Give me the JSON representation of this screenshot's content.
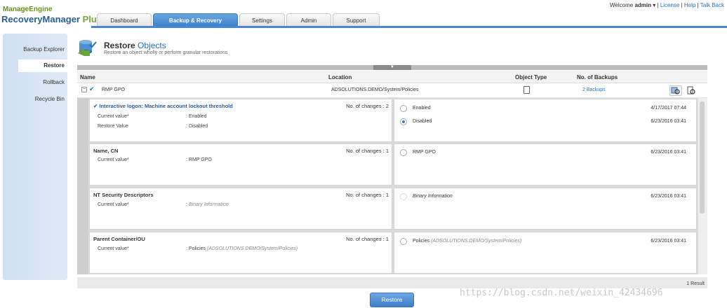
{
  "app": {
    "brand_top": "ManageEngine",
    "brand_main": "RecoveryManager",
    "brand_plus": "Plus"
  },
  "topbar": {
    "welcome": "Welcome",
    "user": "admin",
    "links": [
      "License",
      "Help",
      "Talk Back"
    ]
  },
  "tabs": [
    {
      "label": "Dashboard"
    },
    {
      "label": "Backup & Recovery"
    },
    {
      "label": "Settings"
    },
    {
      "label": "Admin"
    },
    {
      "label": "Support"
    }
  ],
  "sidebar": {
    "items": [
      {
        "label": "Backup Explorer"
      },
      {
        "label": "Restore"
      },
      {
        "label": "Rollback"
      },
      {
        "label": "Recycle Bin"
      }
    ]
  },
  "page": {
    "title_main": "Restore",
    "title_hl": "Objects",
    "subtitle": "Restore an object wholly or perform granular restorations"
  },
  "table": {
    "columns": {
      "name": "Name",
      "location": "Location",
      "type": "Object Type",
      "backups": "No. of Backups"
    },
    "row": {
      "name": "RMP GPO",
      "location": "ADSOLUTIONS.DEMO/System/Policies",
      "backups": "2 Backups"
    }
  },
  "attributes": [
    {
      "title": "Interactive logon: Machine account lockout threshold",
      "changes": "No. of changes : 2",
      "lines": [
        {
          "label": "Current value*",
          "value": ": Enabled"
        },
        {
          "label": "Restore Value",
          "value": ": Disabled"
        }
      ],
      "options": [
        {
          "text": "Enabled",
          "date": "4/17/2017 07:44"
        },
        {
          "text": "Disabled",
          "date": "6/23/2016 03:41"
        }
      ]
    },
    {
      "title": "Name, CN",
      "changes": "No. of changes : 1",
      "lines": [
        {
          "label": "Current value*",
          "value": ": RMP GPO"
        }
      ],
      "options": [
        {
          "text": "RMP GPO",
          "date": "6/23/2016 03:41"
        }
      ]
    },
    {
      "title": "NT Security Descriptors",
      "changes": "No. of changes : 1",
      "lines": [
        {
          "label": "Current value*",
          "value_sep": ":",
          "value": "Binary Information"
        }
      ],
      "options": [
        {
          "text": "Binary Information",
          "date": "6/23/2016 03:41"
        }
      ]
    },
    {
      "title": "Parent Container/OU",
      "changes": "No. of changes : 1",
      "lines": [
        {
          "label": "Current value*",
          "value_sep": ":",
          "value": "Policies",
          "value_extra": "(ADSOLUTIONS.DEMO/System/Policies)"
        }
      ],
      "options": [
        {
          "text": "Policies",
          "text_extra": "(ADSOLUTIONS.DEMO/System/Policies)",
          "date": "6/23/2016 03:41"
        }
      ]
    }
  ],
  "footer": {
    "result_count": "1 Result",
    "restore_button": "Restore"
  },
  "watermark": "https://blog.csdn.net/weixin_42434696",
  "colors": {
    "accent": "#3d7fc9",
    "link": "#2a6ebb",
    "brand_green": "#6a8f1e"
  }
}
